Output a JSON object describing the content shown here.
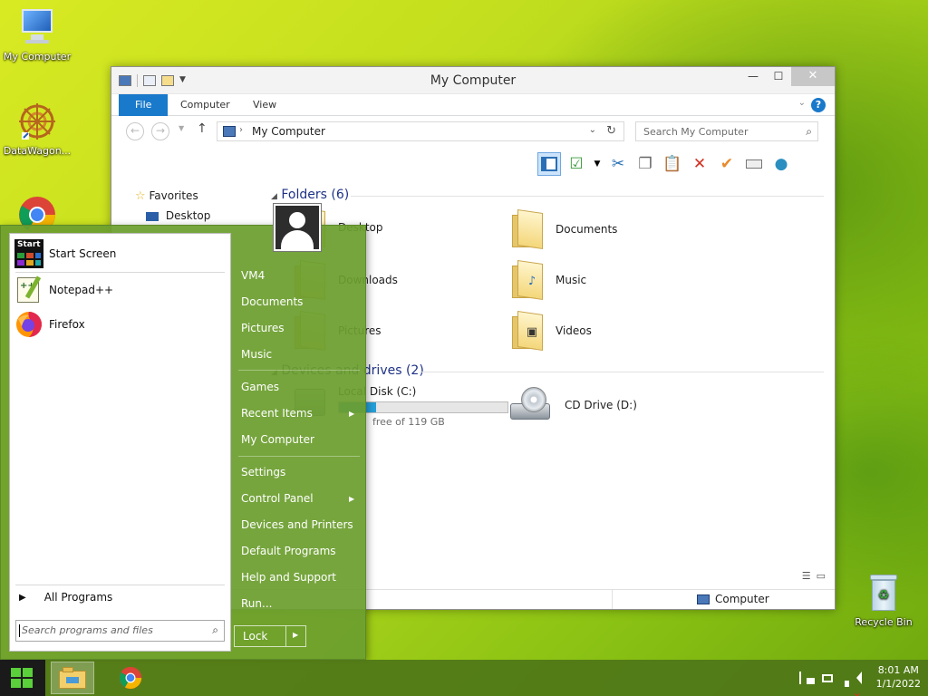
{
  "desktop": {
    "icons": [
      {
        "label": "My Computer"
      },
      {
        "label": "DataWagon..."
      },
      {
        "label": "Recycle Bin"
      }
    ]
  },
  "window": {
    "title": "My Computer",
    "ribbon_tabs": [
      "File",
      "Computer",
      "View"
    ],
    "address": "My Computer",
    "search_placeholder": "Search My Computer",
    "nav": {
      "favorites": "Favorites",
      "desktop": "Desktop"
    },
    "folders_header": "Folders (6)",
    "folders": [
      {
        "name": "Desktop"
      },
      {
        "name": "Documents"
      },
      {
        "name": "Downloads"
      },
      {
        "name": "Music"
      },
      {
        "name": "Pictures"
      },
      {
        "name": "Videos"
      }
    ],
    "drives_header": "Devices and drives (2)",
    "drives": [
      {
        "name": "Local Disk (C:)",
        "free_text": "free of 119 GB"
      },
      {
        "name": "CD Drive (D:)"
      }
    ],
    "status_computer": "Computer"
  },
  "start_menu": {
    "programs": [
      {
        "label": "Start Screen",
        "icon": "start-screen-icon"
      },
      {
        "label": "Notepad++",
        "icon": "notepad-plus-plus-icon"
      },
      {
        "label": "Firefox",
        "icon": "firefox-icon"
      }
    ],
    "all_programs": "All Programs",
    "search_placeholder": "Search programs and files",
    "right_items": [
      {
        "label": "VM4"
      },
      {
        "label": "Documents"
      },
      {
        "label": "Pictures"
      },
      {
        "label": "Music"
      },
      {
        "label": "Games"
      },
      {
        "label": "Recent Items"
      },
      {
        "label": "My Computer"
      },
      {
        "label": "Settings"
      },
      {
        "label": "Control Panel"
      },
      {
        "label": "Devices and Printers"
      },
      {
        "label": "Default Programs"
      },
      {
        "label": "Help and Support"
      },
      {
        "label": "Run..."
      }
    ],
    "lock_label": "Lock"
  },
  "taskbar": {
    "time": "8:01 AM",
    "date": "1/1/2022"
  },
  "colors": {
    "accent": "#1979ca",
    "start_menu": "#6c9e2e",
    "taskbar": "#4e7618"
  }
}
